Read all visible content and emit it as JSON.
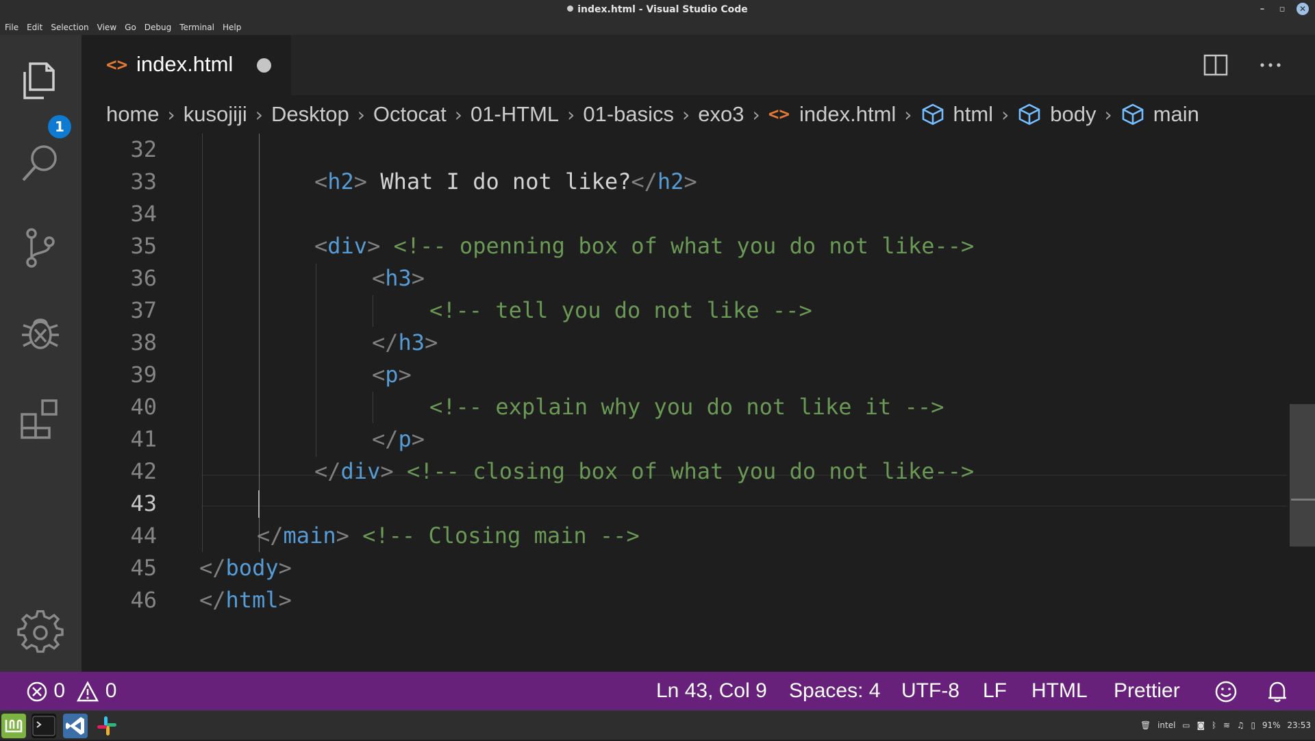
{
  "window": {
    "title": "index.html - Visual Studio Code",
    "minimize": "–",
    "maximize": "▫",
    "close": "✕"
  },
  "menu": [
    "File",
    "Edit",
    "Selection",
    "View",
    "Go",
    "Debug",
    "Terminal",
    "Help"
  ],
  "activity": {
    "explorer_badge": "1"
  },
  "tab": {
    "icon": "<>",
    "name": "index.html"
  },
  "breadcrumbs": {
    "folders": [
      "home",
      "kusojiji",
      "Desktop",
      "Octocat",
      "01-HTML",
      "01-basics",
      "exo3"
    ],
    "file_icon": "<>",
    "file": "index.html",
    "symbols": [
      "html",
      "body",
      "main"
    ],
    "separator": "›"
  },
  "editor": {
    "line_numbers": [
      "32",
      "33",
      "34",
      "35",
      "36",
      "37",
      "38",
      "39",
      "40",
      "41",
      "42",
      "43",
      "44",
      "45",
      "46"
    ],
    "active_line": "43",
    "lines": {
      "l33": {
        "open": "<",
        "tag": "h2",
        "close": ">",
        "text": " What I do not like?",
        "open2": "</",
        "tag2": "h2",
        "close2": ">"
      },
      "l35": {
        "open": "<",
        "tag": "div",
        "close": ">",
        "comment": " <!-- openning box of what you do not like-->"
      },
      "l36": {
        "open": "<",
        "tag": "h3",
        "close": ">"
      },
      "l37": {
        "comment": "<!-- tell you do not like -->"
      },
      "l38": {
        "open": "</",
        "tag": "h3",
        "close": ">"
      },
      "l39": {
        "open": "<",
        "tag": "p",
        "close": ">"
      },
      "l40": {
        "comment": "<!-- explain why you do not like it -->"
      },
      "l41": {
        "open": "</",
        "tag": "p",
        "close": ">"
      },
      "l42": {
        "open": "</",
        "tag": "div",
        "close": ">",
        "comment": " <!-- closing box of what you do not like-->"
      },
      "l44": {
        "open": "</",
        "tag": "main",
        "close": ">",
        "comment": " <!-- Closing main -->"
      },
      "l45": {
        "open": "</",
        "tag": "body",
        "close": ">"
      },
      "l46": {
        "open": "</",
        "tag": "html",
        "close": ">"
      }
    }
  },
  "status": {
    "errors": "0",
    "warnings": "0",
    "position": "Ln 43, Col 9",
    "spaces": "Spaces: 4",
    "encoding": "UTF-8",
    "eol": "LF",
    "language": "HTML",
    "formatter": "Prettier"
  },
  "taskbar": {
    "tray_battery": "91%",
    "tray_time": "23:53",
    "tray_intel": "intel"
  },
  "colors": {
    "statusbar": "#68217a",
    "tag_name": "#569cd6",
    "comment": "#6a9955",
    "file_icon": "#e37933",
    "badge": "#0e7ad1"
  }
}
